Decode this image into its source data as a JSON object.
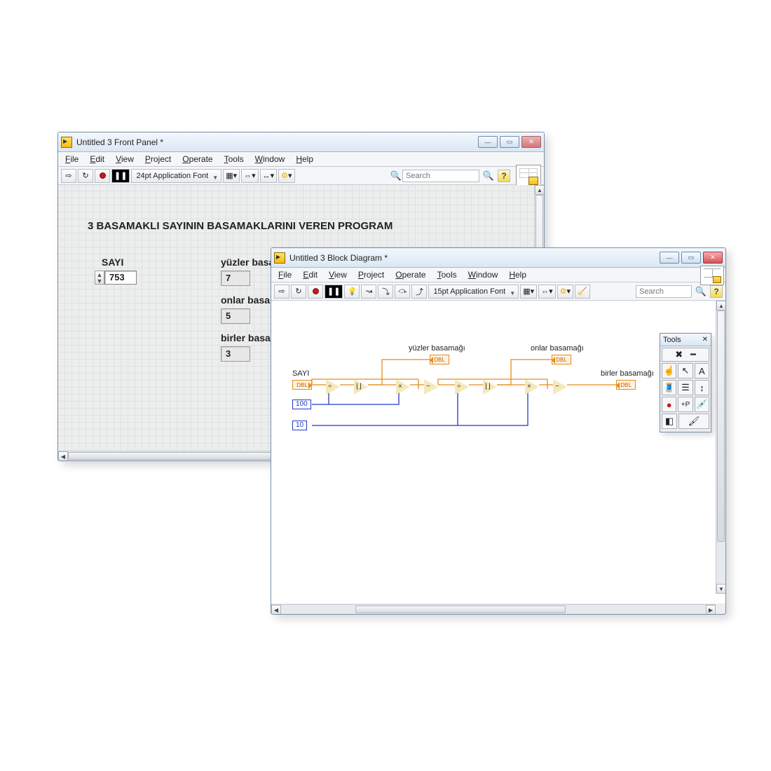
{
  "front_panel": {
    "title": "Untitled 3 Front Panel *",
    "menus": [
      "File",
      "Edit",
      "View",
      "Project",
      "Operate",
      "Tools",
      "Window",
      "Help"
    ],
    "font": "24pt Application Font",
    "search_placeholder": "Search",
    "heading": "3 BASAMAKLI SAYININ BASAMAKLARINI VEREN PROGRAM",
    "control": {
      "label": "SAYI",
      "value": "753"
    },
    "indicators": [
      {
        "label": "yüzler basamağı",
        "value": "7"
      },
      {
        "label": "onlar basamağı",
        "value": "5"
      },
      {
        "label": "birler basamağı",
        "value": "3"
      }
    ]
  },
  "block_diagram": {
    "title": "Untitled 3 Block Diagram *",
    "menus": [
      "File",
      "Edit",
      "View",
      "Project",
      "Operate",
      "Tools",
      "Window",
      "Help"
    ],
    "font": "15pt Application Font",
    "search_placeholder": "Search",
    "terminals": {
      "sayi": {
        "label": "SAYI",
        "type": "DBL"
      },
      "yuzler": {
        "label": "yüzler basamağı",
        "type": "DBL"
      },
      "onlar": {
        "label": "onlar basamağı",
        "type": "DBL"
      },
      "birler": {
        "label": "birler basamağı",
        "type": "DBL"
      }
    },
    "constants": {
      "c100": "100",
      "c10": "10"
    },
    "tools_title": "Tools"
  }
}
